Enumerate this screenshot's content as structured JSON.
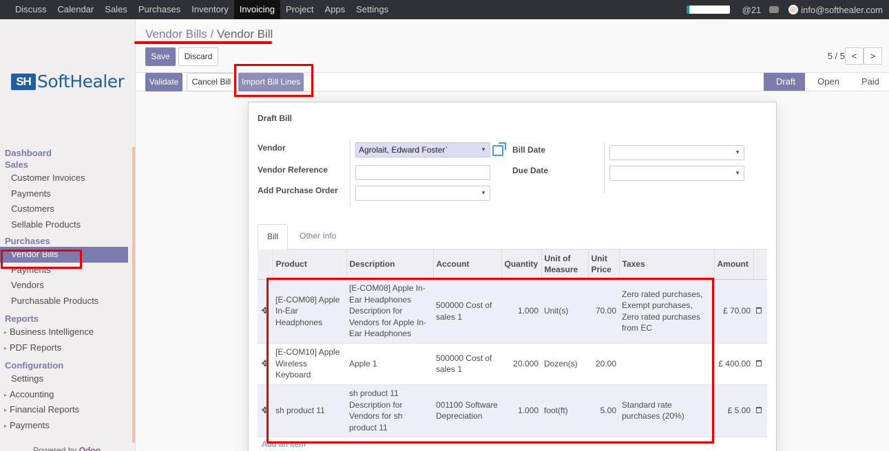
{
  "topbar": {
    "menu": [
      "Discuss",
      "Calendar",
      "Sales",
      "Purchases",
      "Inventory",
      "Invoicing",
      "Project",
      "Apps",
      "Settings"
    ],
    "active_index": 5,
    "mention_count": "21",
    "user": "info@softhealer.com"
  },
  "brand": {
    "mark": "SH",
    "text": "SoftHealer"
  },
  "sidebar": {
    "dashboard": "Dashboard",
    "sales": "Sales",
    "sales_items": [
      "Customer Invoices",
      "Payments",
      "Customers",
      "Sellable Products"
    ],
    "purchases": "Purchases",
    "purchase_items": [
      "Vendor Bills",
      "Payments",
      "Vendors",
      "Purchasable Products"
    ],
    "reports": "Reports",
    "report_items": [
      "Business Intelligence",
      "PDF Reports"
    ],
    "configuration": "Configuration",
    "config_items": [
      "Settings",
      "Accounting",
      "Financial Reports",
      "Payments"
    ],
    "powered_prefix": "Powered by",
    "powered_brand": "Odoo"
  },
  "breadcrumb": {
    "parent": "Vendor Bills",
    "sep": "/",
    "current": "Vendor Bill"
  },
  "buttons": {
    "save": "Save",
    "discard": "Discard",
    "validate": "Validate",
    "cancel_bill": "Cancel Bill",
    "import_lines": "Import Bill Lines"
  },
  "pager": {
    "text": "5 / 5",
    "prev": "<",
    "next": ">"
  },
  "stages": [
    "Draft",
    "Open",
    "Paid"
  ],
  "form": {
    "title": "Draft Bill",
    "vendor_label": "Vendor",
    "vendor_value": "Agrolait, Edward Foster`",
    "vendor_ref_label": "Vendor Reference",
    "add_po_label": "Add Purchase Order",
    "bill_date_label": "Bill Date",
    "due_date_label": "Due Date"
  },
  "tabs": [
    "Bill",
    "Other Info"
  ],
  "table": {
    "headers": [
      "Product",
      "Description",
      "Account",
      "Quantity",
      "Unit of Measure",
      "Unit Price",
      "Taxes",
      "Amount"
    ],
    "rows": [
      {
        "product": "[E-COM08] Apple In-Ear Headphones",
        "description": "[E-COM08] Apple In-Ear Headphones  Description for Vendors for Apple In-Ear Headphones",
        "account": "500000 Cost of sales 1",
        "quantity": "1.000",
        "uom": "Unit(s)",
        "price": "70.00",
        "taxes": "Zero rated purchases, Exempt purchases, Zero rated purchases from EC",
        "amount": "£ 70.00"
      },
      {
        "product": "[E-COM10] Apple Wireless Keyboard",
        "description": "Apple 1",
        "account": "500000 Cost of sales 1",
        "quantity": "20.000",
        "uom": "Dozen(s)",
        "price": "20.00",
        "taxes": "",
        "amount": "£ 400.00"
      },
      {
        "product": "sh product 11",
        "description": "sh product 11  Description for Vendors for sh product 11",
        "account": "001100 Software Depreciation",
        "quantity": "1.000",
        "uom": "foot(ft)",
        "price": "5.00",
        "taxes": "Standard rate purchases (20%)",
        "amount": "£ 5.00"
      }
    ],
    "add_item": "Add an item"
  }
}
